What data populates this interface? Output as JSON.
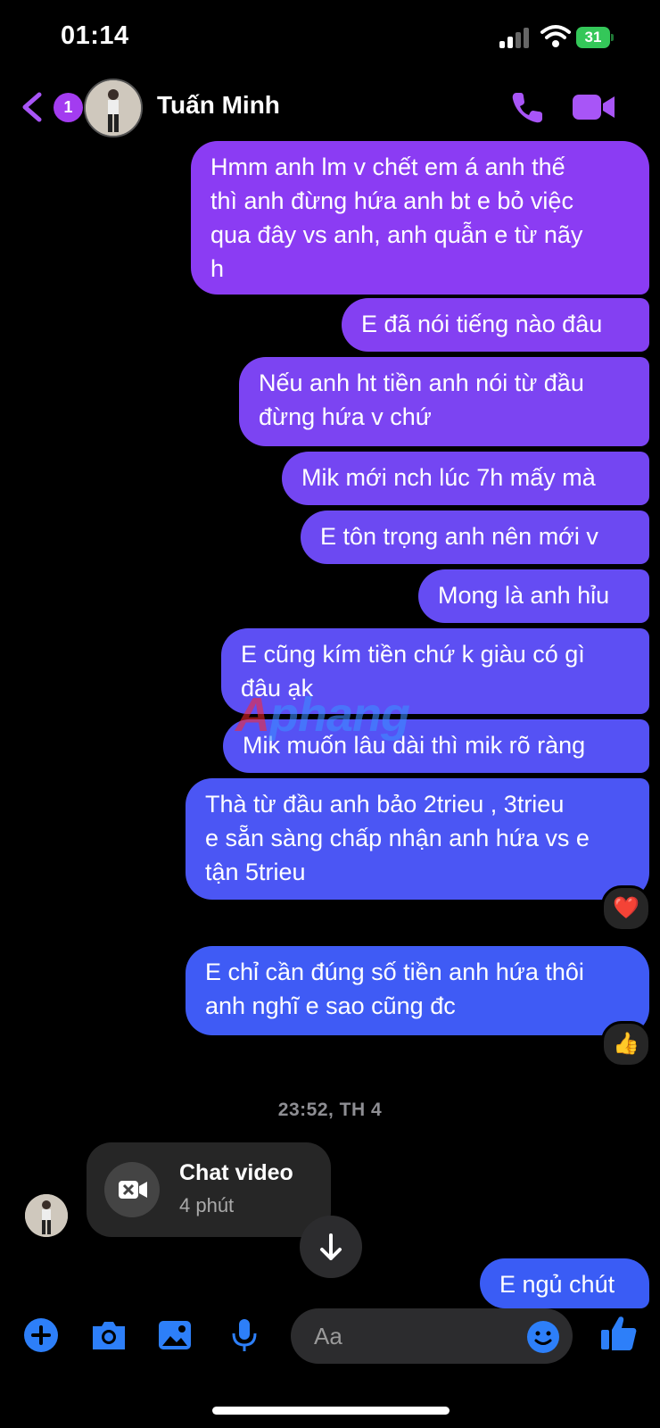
{
  "status": {
    "time": "01:14",
    "battery": "31"
  },
  "header": {
    "back_count": "1",
    "contact_name": "Tuấn Minh"
  },
  "messages": [
    {
      "text": "Hmm anh lm v chết em á anh thế\nthì anh đừng hứa anh bt e bỏ việc\nqua đây vs anh, anh quẫn e từ nãy\nh"
    },
    {
      "text": "E đã nói tiếng nào đâu"
    },
    {
      "text": "Nếu anh ht tiền anh nói từ đầu\nđừng hứa v chứ"
    },
    {
      "text": "Mik mới nch lúc 7h mấy mà"
    },
    {
      "text": "E tôn trọng anh nên mới v"
    },
    {
      "text": "Mong là anh hỉu"
    },
    {
      "text": "E cũng kím tiền chứ k giàu có gì\nđâu ạk"
    },
    {
      "text": "Mik muốn lâu dài thì mik rõ ràng"
    },
    {
      "text": "Thà từ đầu anh bảo 2trieu , 3trieu\ne sẵn sàng chấp nhận anh hứa vs e\ntận 5trieu",
      "reaction": "❤️"
    },
    {
      "text": "E chỉ cần đúng số tiền anh hứa thôi\nanh nghĩ e sao cũng đc",
      "reaction": "👍"
    },
    {
      "text": "E ngủ chút"
    }
  ],
  "timestamp": "23:52, TH 4",
  "video_call": {
    "title": "Chat video",
    "duration": "4 phút"
  },
  "composer": {
    "placeholder": "Aa"
  },
  "watermark": {
    "part1": "A",
    "part2": "phang"
  },
  "colors": {
    "bubble_top": "#8a3cf2",
    "bubble_bottom": "#3a5cf5",
    "accent": "#a855f7",
    "action_blue": "#2d7ff9"
  }
}
